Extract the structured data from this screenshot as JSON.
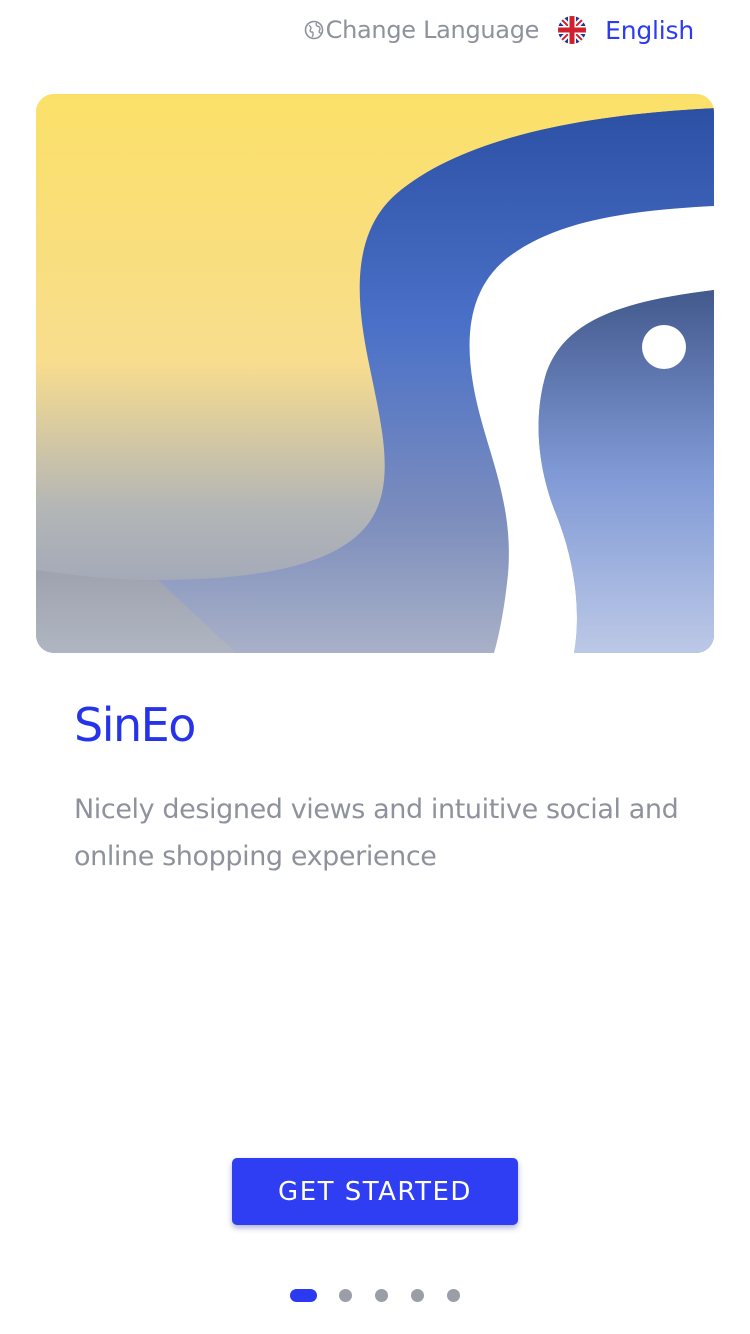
{
  "header": {
    "change_language_label": "Change Language",
    "current_language": "English",
    "globe_icon": "globe-icon",
    "flag_icon": "uk-flag-icon"
  },
  "hero": {
    "image_icon": "sineo-logo-artwork"
  },
  "intro": {
    "title": "SinEo",
    "description": "Nicely designed views and intuitive social and online shopping experience"
  },
  "cta": {
    "label": "GET STARTED"
  },
  "pager": {
    "total": 5,
    "active_index": 0
  },
  "colors": {
    "accent": "#2f3ef2",
    "muted_text": "#8d929c",
    "hero_yellow": "#fbe06a",
    "hero_blue": "#4a6fc7"
  }
}
